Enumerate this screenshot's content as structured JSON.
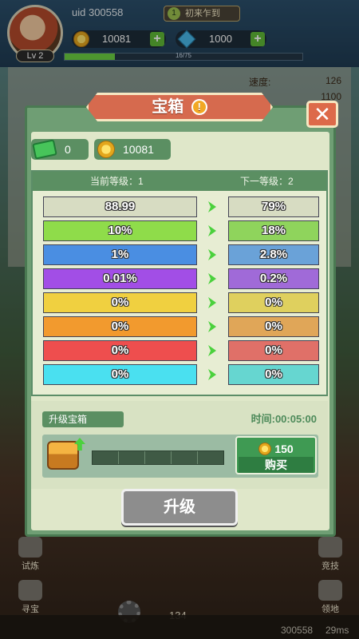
{
  "hud": {
    "uid": "uid 300558",
    "level": "Lv 2",
    "title_number": "1",
    "title_text": "初来乍到",
    "coins": "10081",
    "gems": "1000",
    "xp_text": "16/75",
    "xp_fraction": 0.21,
    "stat_label_1": "速度:",
    "stat_value_1": "126",
    "stat_value_2": "1100"
  },
  "side_menu": {
    "trial": "试炼",
    "treasure": "寻宝",
    "arena": "竞技",
    "territory": "领地"
  },
  "footer": {
    "counter": "134",
    "uid": "300558",
    "latency": "29ms"
  },
  "dialog": {
    "title": "宝箱",
    "info_icon": "!",
    "close": "✕",
    "gem_amount": "0",
    "coin_amount": "10081",
    "current_level": "当前等级：1",
    "next_level": "下一等级：2",
    "rows": [
      {
        "current": "88.99",
        "next": "79%",
        "cur_color": "#d7dcc2",
        "next_color": "#d7dcc2"
      },
      {
        "current": "10%",
        "next": "18%",
        "cur_color": "#8fdc4a",
        "next_color": "#8fd45c"
      },
      {
        "current": "1%",
        "next": "2.8%",
        "cur_color": "#4a8ee2",
        "next_color": "#6aa2d8"
      },
      {
        "current": "0.01%",
        "next": "0.2%",
        "cur_color": "#a24ee6",
        "next_color": "#a06ad8"
      },
      {
        "current": "0%",
        "next": "0%",
        "cur_color": "#f0d040",
        "next_color": "#dfd05e"
      },
      {
        "current": "0%",
        "next": "0%",
        "cur_color": "#f29a2e",
        "next_color": "#e0a658"
      },
      {
        "current": "0%",
        "next": "0%",
        "cur_color": "#ee4e4e",
        "next_color": "#e07068"
      },
      {
        "current": "0%",
        "next": "0%",
        "cur_color": "#4ae0f0",
        "next_color": "#66d6d0"
      }
    ],
    "upgrade_label": "升级宝箱",
    "timer": "时间:00:05:00",
    "buy_cost": "150",
    "buy_label": "购买",
    "upgrade_button": "升级"
  }
}
